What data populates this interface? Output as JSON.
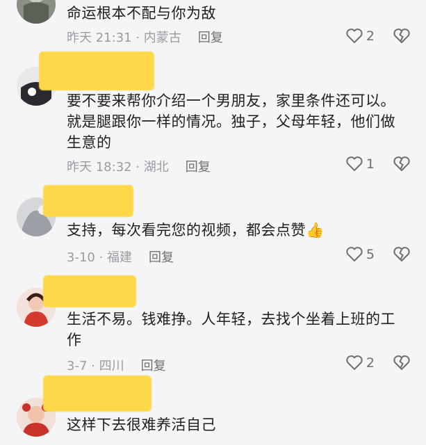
{
  "comments": [
    {
      "text": "命运根本不配与你为敌",
      "meta": "昨天 21:31 · 内蒙古",
      "reply_label": "回复",
      "likes": "2"
    },
    {
      "text": "要不要来帮你介绍一个男朋友，家里条件还可以。就是腿跟你一样的情况。独子，父母年轻，他们做生意的",
      "meta": "昨天 18:32 · 湖北",
      "reply_label": "回复",
      "likes": "1"
    },
    {
      "text": "支持，每次看完您的视频，都会点赞",
      "emoji": "👍",
      "meta": "3-10 · 福建",
      "reply_label": "回复",
      "likes": "5"
    },
    {
      "text": "生活不易。钱难挣。人年轻，去找个坐着上班的工作",
      "meta": "3-7 · 四川",
      "reply_label": "回复",
      "likes": "2"
    },
    {
      "text": "这样下去很难养活自己"
    }
  ],
  "colors": {
    "background": "#f5f5f7",
    "username_redaction": "#ffd84a",
    "meta_text": "#9b9ba0"
  },
  "icons": {
    "like": "heart-outline-icon",
    "dislike": "broken-heart-icon"
  }
}
